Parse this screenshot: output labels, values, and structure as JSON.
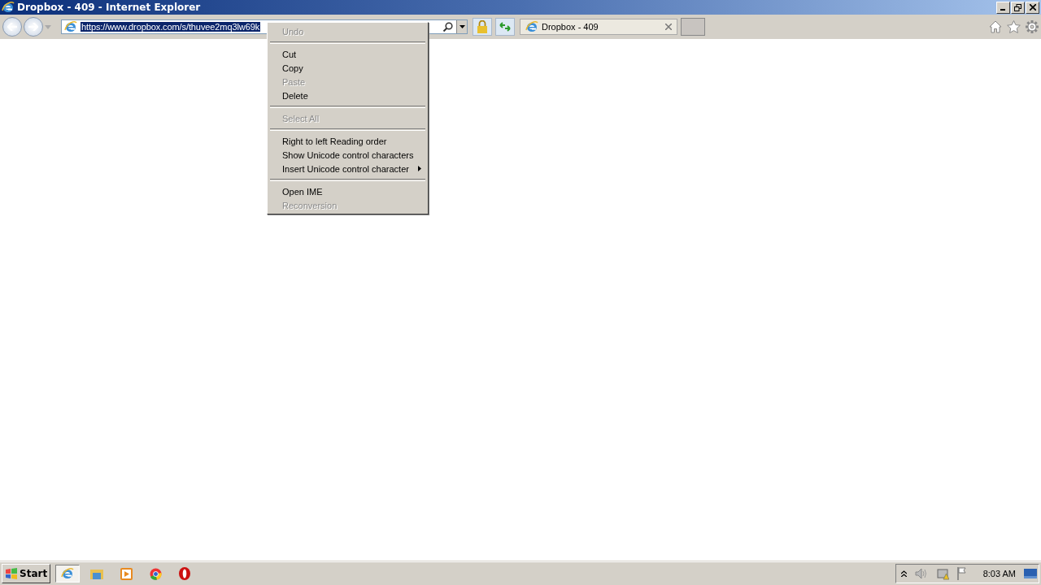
{
  "window": {
    "title": "Dropbox - 409 - Internet Explorer"
  },
  "address": {
    "value": "https://www.dropbox.com/s/thuvee2mq3lw69k",
    "selected": true
  },
  "tab": {
    "label": "Dropbox - 409",
    "selected": true
  },
  "context_menu": [
    {
      "kind": "item",
      "label": "Undo",
      "disabled": true,
      "submenu": false
    },
    {
      "kind": "separator"
    },
    {
      "kind": "item",
      "label": "Cut",
      "disabled": false,
      "submenu": false
    },
    {
      "kind": "item",
      "label": "Copy",
      "disabled": false,
      "submenu": false
    },
    {
      "kind": "item",
      "label": "Paste",
      "disabled": true,
      "submenu": false
    },
    {
      "kind": "item",
      "label": "Delete",
      "disabled": false,
      "submenu": false
    },
    {
      "kind": "separator"
    },
    {
      "kind": "item",
      "label": "Select All",
      "disabled": true,
      "submenu": false
    },
    {
      "kind": "separator"
    },
    {
      "kind": "item",
      "label": "Right to left Reading order",
      "disabled": false,
      "submenu": false
    },
    {
      "kind": "item",
      "label": "Show Unicode control characters",
      "disabled": false,
      "submenu": false
    },
    {
      "kind": "item",
      "label": "Insert Unicode control character",
      "disabled": false,
      "submenu": true
    },
    {
      "kind": "separator"
    },
    {
      "kind": "item",
      "label": "Open IME",
      "disabled": false,
      "submenu": false
    },
    {
      "kind": "item",
      "label": "Reconversion",
      "disabled": true,
      "submenu": false
    }
  ],
  "taskbar": {
    "start": "Start",
    "apps": [
      {
        "kind": "ie",
        "selected": true
      },
      {
        "kind": "folder",
        "selected": false
      },
      {
        "kind": "media",
        "selected": false
      },
      {
        "kind": "chrome",
        "selected": false
      },
      {
        "kind": "opera",
        "selected": false
      }
    ],
    "clock": "8:03 AM"
  }
}
